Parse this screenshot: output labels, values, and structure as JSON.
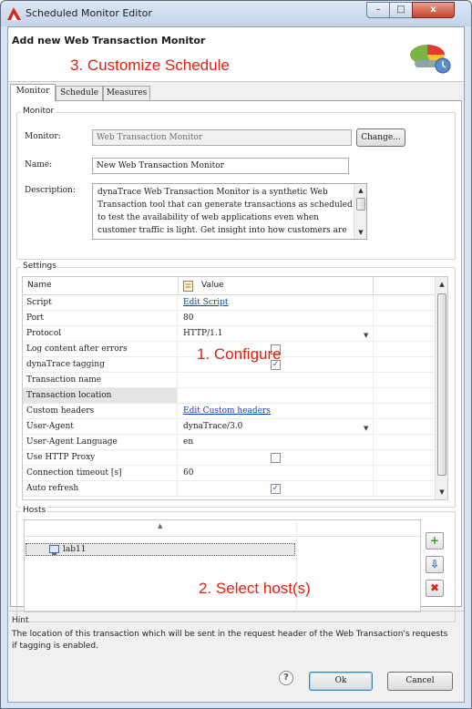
{
  "window": {
    "title": "Scheduled Monitor Editor",
    "min": "–",
    "max": "□",
    "close": "x"
  },
  "header": {
    "title": "Add new Web Transaction Monitor",
    "annotation": "3. Customize Schedule"
  },
  "tabs": [
    {
      "label": "Monitor",
      "active": true
    },
    {
      "label": "Schedule",
      "active": false
    },
    {
      "label": "Measures",
      "active": false
    }
  ],
  "monitor_group": {
    "title": "Monitor",
    "monitor_label": "Monitor:",
    "monitor_value": "Web Transaction Monitor",
    "change_button": "Change...",
    "name_label": "Name:",
    "name_value": "New Web Transaction Monitor",
    "description_label": "Description:",
    "description_value": "dynaTrace Web Transaction Monitor is a synthetic Web Transaction tool that can generate transactions as scheduled to test the availability of web applications even when customer traffic is light. Get insight into how customers are"
  },
  "settings": {
    "title": "Settings",
    "col_name": "Name",
    "col_value": "Value",
    "annotation": "1. Configure",
    "rows": [
      {
        "name": "Script",
        "value": "Edit Script",
        "kind": "link"
      },
      {
        "name": "Port",
        "value": "80",
        "kind": "text"
      },
      {
        "name": "Protocol",
        "value": "HTTP/1.1",
        "kind": "dropdown"
      },
      {
        "name": "Log content after errors",
        "value": "",
        "kind": "checkbox",
        "checked": false
      },
      {
        "name": "dynaTrace tagging",
        "value": "",
        "kind": "checkbox",
        "checked": true
      },
      {
        "name": "Transaction name",
        "value": "",
        "kind": "text"
      },
      {
        "name": "Transaction location",
        "value": "",
        "kind": "text",
        "selected": true
      },
      {
        "name": "Custom headers",
        "value": "Edit Custom headers",
        "kind": "link"
      },
      {
        "name": "User-Agent",
        "value": "dynaTrace/3.0",
        "kind": "dropdown"
      },
      {
        "name": "User-Agent Language",
        "value": "en",
        "kind": "text"
      },
      {
        "name": "Use HTTP Proxy",
        "value": "",
        "kind": "checkbox",
        "checked": false
      },
      {
        "name": "Connection timeout [s]",
        "value": "60",
        "kind": "text"
      },
      {
        "name": "Auto refresh",
        "value": "",
        "kind": "checkbox",
        "checked": true
      }
    ]
  },
  "hosts": {
    "title": "Hosts",
    "items": [
      {
        "label": "lab11"
      }
    ],
    "annotation": "2. Select host(s)",
    "add_button": "+",
    "import_button": "⇩",
    "remove_button": "✖"
  },
  "hint": {
    "title": "Hint",
    "text": "The location of this transaction which will be sent in the request header of the Web Transaction's requests if tagging is enabled."
  },
  "footer": {
    "help": "?",
    "ok": "Ok",
    "cancel": "Cancel"
  }
}
